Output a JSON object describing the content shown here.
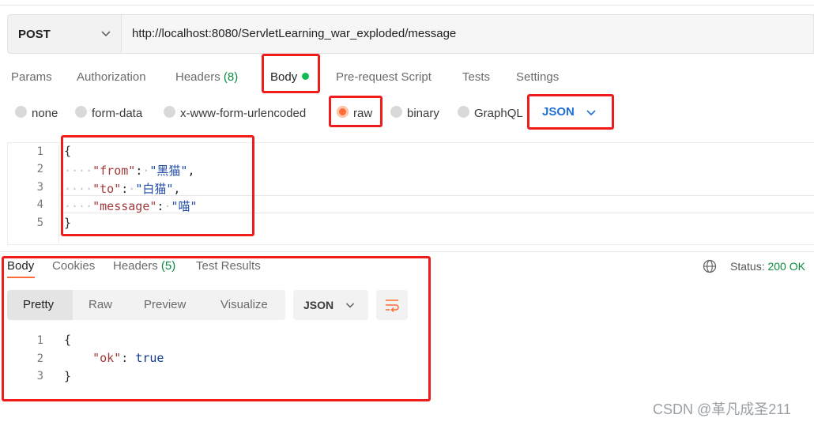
{
  "request": {
    "method": "POST",
    "url": "http://localhost:8080/ServletLearning_war_exploded/message"
  },
  "request_tabs": {
    "params": "Params",
    "authorization": "Authorization",
    "headers": "Headers",
    "headers_count": "(8)",
    "body": "Body",
    "pre_request": "Pre-request Script",
    "tests": "Tests",
    "settings": "Settings"
  },
  "body_types": {
    "none": "none",
    "form_data": "form-data",
    "urlencoded": "x-www-form-urlencoded",
    "raw": "raw",
    "binary": "binary",
    "graphql": "GraphQL",
    "selected": "raw",
    "format": "JSON"
  },
  "request_body": {
    "line_numbers": [
      "1",
      "2",
      "3",
      "4",
      "5"
    ],
    "open_brace": "{",
    "close_brace": "}",
    "fields": [
      {
        "key": "\"from\"",
        "colon": ":",
        "value": "\"黑猫\"",
        "comma": ","
      },
      {
        "key": "\"to\"",
        "colon": ":",
        "value": "\"白猫\"",
        "comma": ","
      },
      {
        "key": "\"message\"",
        "colon": ":",
        "value": "\"喵\"",
        "comma": ""
      }
    ]
  },
  "response_tabs": {
    "body": "Body",
    "cookies": "Cookies",
    "headers": "Headers",
    "headers_count": "(5)",
    "test_results": "Test Results"
  },
  "status": {
    "label": "Status:",
    "value": "200 OK"
  },
  "response_view": {
    "pretty": "Pretty",
    "raw": "Raw",
    "preview": "Preview",
    "visualize": "Visualize",
    "format": "JSON"
  },
  "response_body": {
    "line_numbers": [
      "1",
      "2",
      "3"
    ],
    "open_brace": "{",
    "close_brace": "}",
    "key": "\"ok\"",
    "colon": ":",
    "value": "true"
  },
  "watermark": "CSDN @革凡成圣211",
  "colors": {
    "accent": "#ff6c37",
    "annotation": "#ee1c1c",
    "success": "#0b8a3e",
    "json_link": "#1f6fd6"
  },
  "icons": [
    "chevron-down-icon",
    "globe-icon",
    "wrap-lines-icon"
  ]
}
